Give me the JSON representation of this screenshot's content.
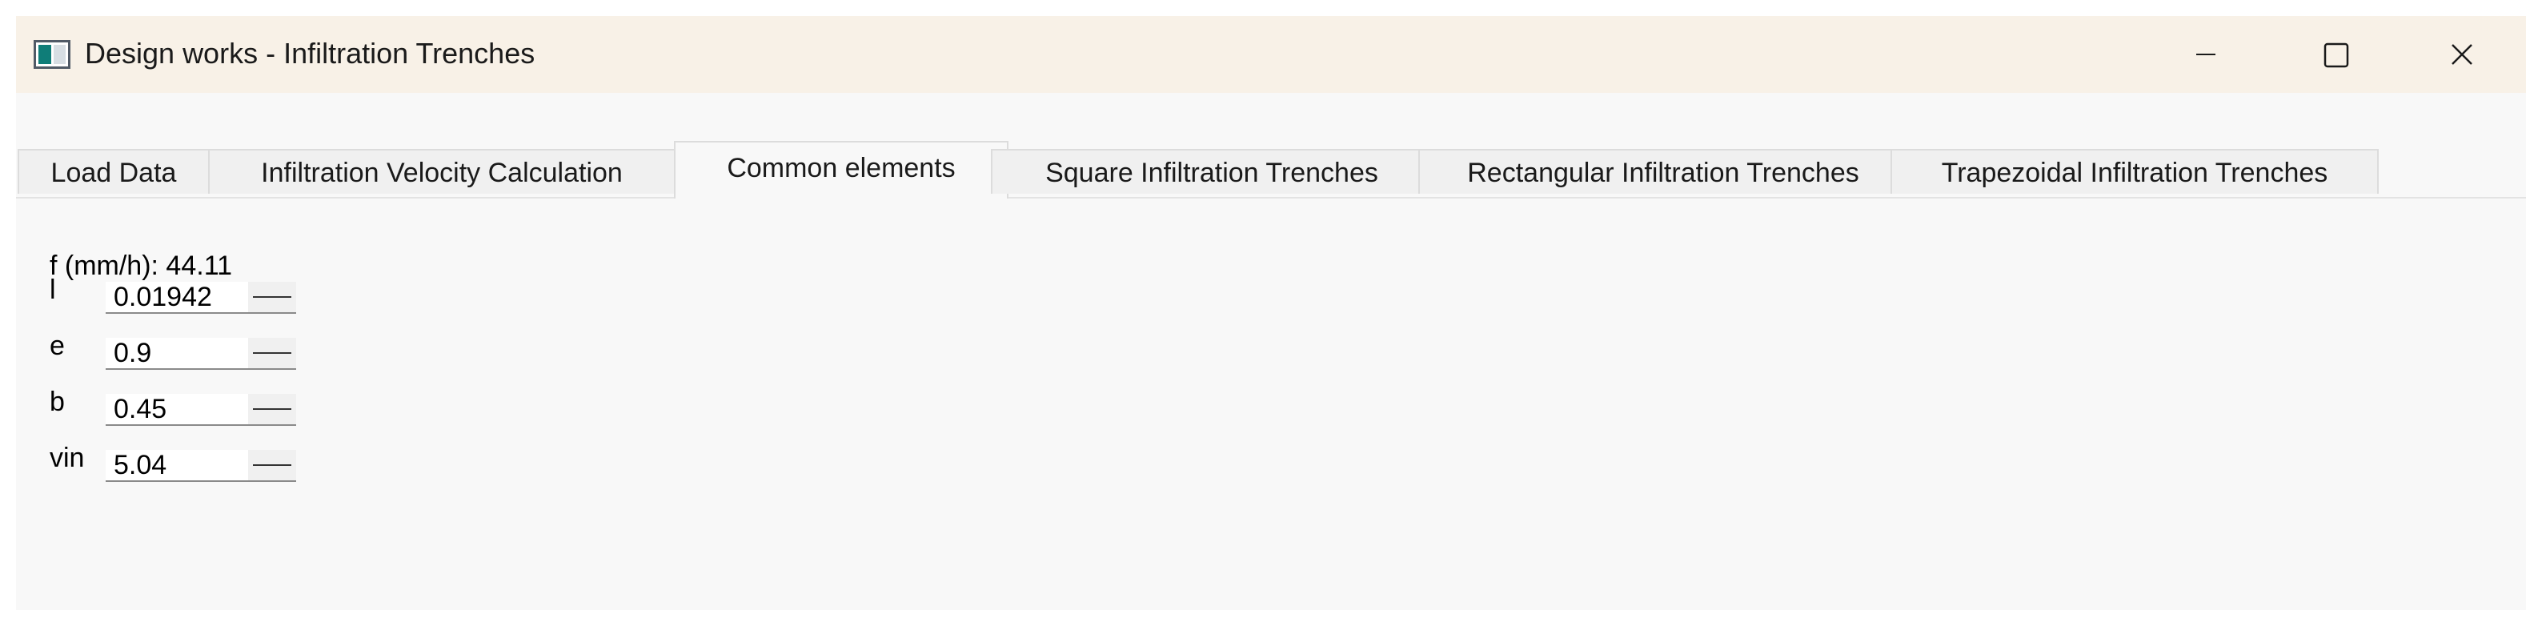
{
  "window": {
    "title": "Design works - Infiltration Trenches",
    "icon": "app-window-icon",
    "controls": {
      "minimize_icon": "minimize-icon",
      "maximize_icon": "maximize-icon",
      "close_icon": "close-icon"
    }
  },
  "tabs": [
    {
      "label": "Load Data",
      "active": false
    },
    {
      "label": "Infiltration Velocity Calculation",
      "active": false
    },
    {
      "label": "Common elements",
      "active": true
    },
    {
      "label": "Square Infiltration Trenches",
      "active": false
    },
    {
      "label": "Rectangular Infiltration Trenches",
      "active": false
    },
    {
      "label": "Trapezoidal Infiltration Trenches",
      "active": false
    }
  ],
  "common": {
    "f_text": "f (mm/h): 44.11",
    "fields": [
      {
        "label": "l",
        "value": "0.01942"
      },
      {
        "label": "e",
        "value": "0.9"
      },
      {
        "label": "b",
        "value": "0.45"
      },
      {
        "label": "vin",
        "value": "5.04"
      }
    ]
  }
}
